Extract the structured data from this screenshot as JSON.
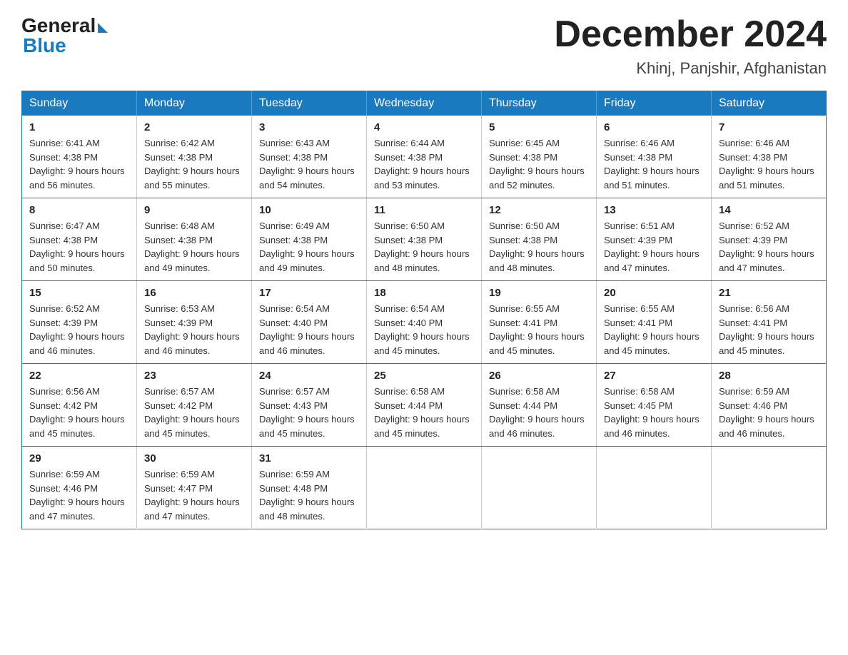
{
  "logo": {
    "general": "General",
    "blue": "Blue"
  },
  "title": {
    "month_year": "December 2024",
    "location": "Khinj, Panjshir, Afghanistan"
  },
  "days_of_week": [
    "Sunday",
    "Monday",
    "Tuesday",
    "Wednesday",
    "Thursday",
    "Friday",
    "Saturday"
  ],
  "weeks": [
    [
      {
        "day": "1",
        "sunrise": "6:41 AM",
        "sunset": "4:38 PM",
        "daylight": "9 hours and 56 minutes."
      },
      {
        "day": "2",
        "sunrise": "6:42 AM",
        "sunset": "4:38 PM",
        "daylight": "9 hours and 55 minutes."
      },
      {
        "day": "3",
        "sunrise": "6:43 AM",
        "sunset": "4:38 PM",
        "daylight": "9 hours and 54 minutes."
      },
      {
        "day": "4",
        "sunrise": "6:44 AM",
        "sunset": "4:38 PM",
        "daylight": "9 hours and 53 minutes."
      },
      {
        "day": "5",
        "sunrise": "6:45 AM",
        "sunset": "4:38 PM",
        "daylight": "9 hours and 52 minutes."
      },
      {
        "day": "6",
        "sunrise": "6:46 AM",
        "sunset": "4:38 PM",
        "daylight": "9 hours and 51 minutes."
      },
      {
        "day": "7",
        "sunrise": "6:46 AM",
        "sunset": "4:38 PM",
        "daylight": "9 hours and 51 minutes."
      }
    ],
    [
      {
        "day": "8",
        "sunrise": "6:47 AM",
        "sunset": "4:38 PM",
        "daylight": "9 hours and 50 minutes."
      },
      {
        "day": "9",
        "sunrise": "6:48 AM",
        "sunset": "4:38 PM",
        "daylight": "9 hours and 49 minutes."
      },
      {
        "day": "10",
        "sunrise": "6:49 AM",
        "sunset": "4:38 PM",
        "daylight": "9 hours and 49 minutes."
      },
      {
        "day": "11",
        "sunrise": "6:50 AM",
        "sunset": "4:38 PM",
        "daylight": "9 hours and 48 minutes."
      },
      {
        "day": "12",
        "sunrise": "6:50 AM",
        "sunset": "4:38 PM",
        "daylight": "9 hours and 48 minutes."
      },
      {
        "day": "13",
        "sunrise": "6:51 AM",
        "sunset": "4:39 PM",
        "daylight": "9 hours and 47 minutes."
      },
      {
        "day": "14",
        "sunrise": "6:52 AM",
        "sunset": "4:39 PM",
        "daylight": "9 hours and 47 minutes."
      }
    ],
    [
      {
        "day": "15",
        "sunrise": "6:52 AM",
        "sunset": "4:39 PM",
        "daylight": "9 hours and 46 minutes."
      },
      {
        "day": "16",
        "sunrise": "6:53 AM",
        "sunset": "4:39 PM",
        "daylight": "9 hours and 46 minutes."
      },
      {
        "day": "17",
        "sunrise": "6:54 AM",
        "sunset": "4:40 PM",
        "daylight": "9 hours and 46 minutes."
      },
      {
        "day": "18",
        "sunrise": "6:54 AM",
        "sunset": "4:40 PM",
        "daylight": "9 hours and 45 minutes."
      },
      {
        "day": "19",
        "sunrise": "6:55 AM",
        "sunset": "4:41 PM",
        "daylight": "9 hours and 45 minutes."
      },
      {
        "day": "20",
        "sunrise": "6:55 AM",
        "sunset": "4:41 PM",
        "daylight": "9 hours and 45 minutes."
      },
      {
        "day": "21",
        "sunrise": "6:56 AM",
        "sunset": "4:41 PM",
        "daylight": "9 hours and 45 minutes."
      }
    ],
    [
      {
        "day": "22",
        "sunrise": "6:56 AM",
        "sunset": "4:42 PM",
        "daylight": "9 hours and 45 minutes."
      },
      {
        "day": "23",
        "sunrise": "6:57 AM",
        "sunset": "4:42 PM",
        "daylight": "9 hours and 45 minutes."
      },
      {
        "day": "24",
        "sunrise": "6:57 AM",
        "sunset": "4:43 PM",
        "daylight": "9 hours and 45 minutes."
      },
      {
        "day": "25",
        "sunrise": "6:58 AM",
        "sunset": "4:44 PM",
        "daylight": "9 hours and 45 minutes."
      },
      {
        "day": "26",
        "sunrise": "6:58 AM",
        "sunset": "4:44 PM",
        "daylight": "9 hours and 46 minutes."
      },
      {
        "day": "27",
        "sunrise": "6:58 AM",
        "sunset": "4:45 PM",
        "daylight": "9 hours and 46 minutes."
      },
      {
        "day": "28",
        "sunrise": "6:59 AM",
        "sunset": "4:46 PM",
        "daylight": "9 hours and 46 minutes."
      }
    ],
    [
      {
        "day": "29",
        "sunrise": "6:59 AM",
        "sunset": "4:46 PM",
        "daylight": "9 hours and 47 minutes."
      },
      {
        "day": "30",
        "sunrise": "6:59 AM",
        "sunset": "4:47 PM",
        "daylight": "9 hours and 47 minutes."
      },
      {
        "day": "31",
        "sunrise": "6:59 AM",
        "sunset": "4:48 PM",
        "daylight": "9 hours and 48 minutes."
      },
      null,
      null,
      null,
      null
    ]
  ]
}
